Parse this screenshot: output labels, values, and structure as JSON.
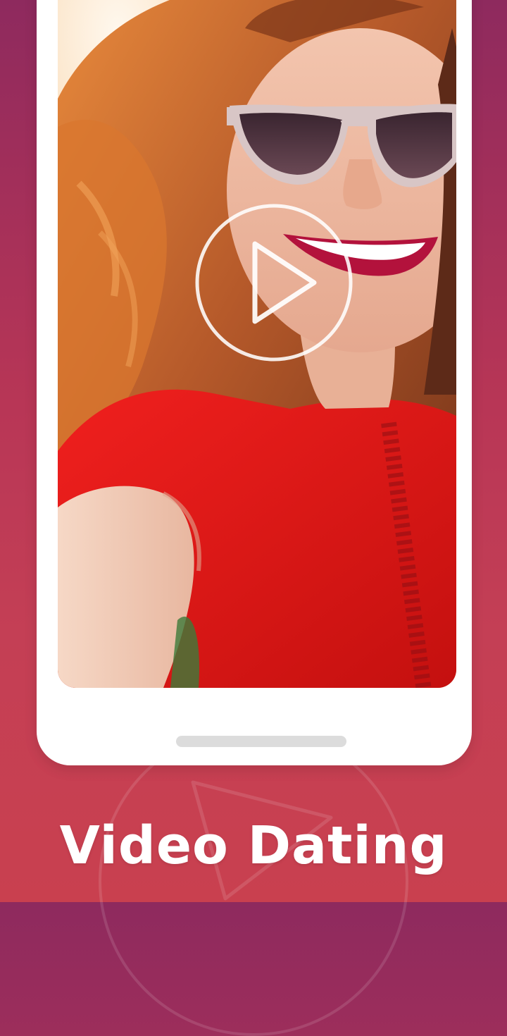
{
  "promo": {
    "headline": "Video Dating"
  },
  "screen": {
    "media": "selfie-photo",
    "overlay_icon": "play-icon"
  },
  "colors": {
    "background_top": "#8e2a5e",
    "background_bottom": "#c9404f",
    "frame": "#ffffff",
    "home_indicator": "#dcdcdc"
  }
}
